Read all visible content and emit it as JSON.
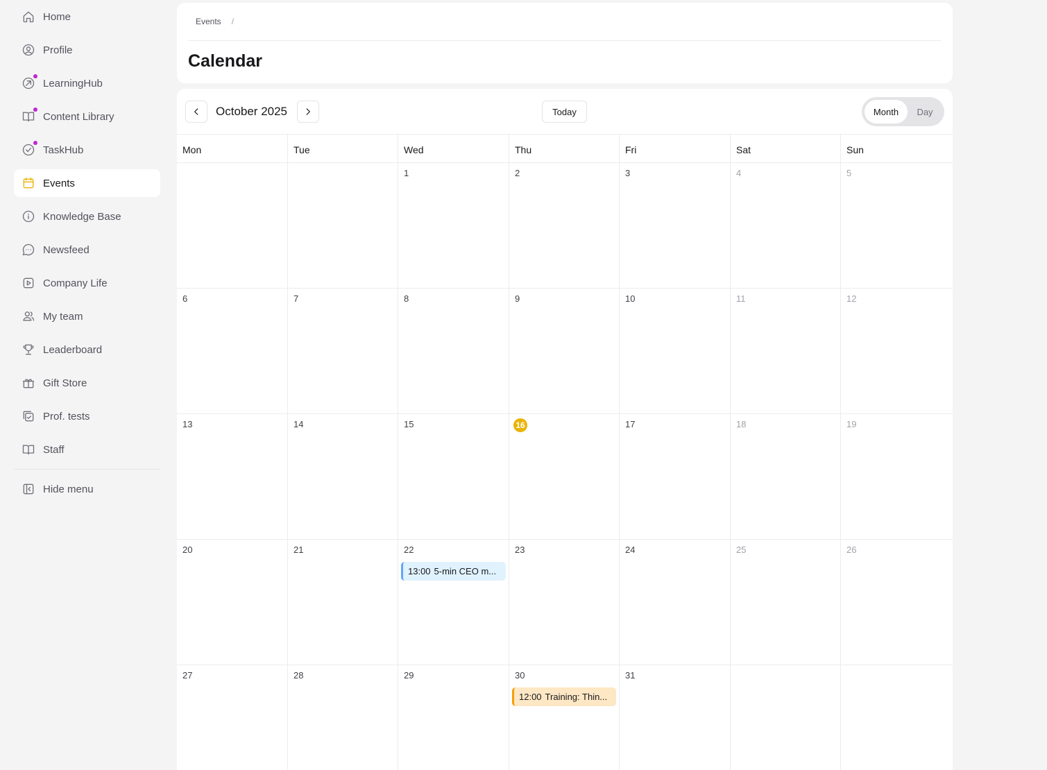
{
  "sidebar": {
    "items": [
      {
        "label": "Home",
        "icon": "home-icon",
        "dot": false,
        "active": false
      },
      {
        "label": "Profile",
        "icon": "user-circle-icon",
        "dot": false,
        "active": false
      },
      {
        "label": "LearningHub",
        "icon": "learning-icon",
        "dot": true,
        "active": false
      },
      {
        "label": "Content Library",
        "icon": "book-open-icon",
        "dot": true,
        "active": false
      },
      {
        "label": "TaskHub",
        "icon": "check-circle-icon",
        "dot": true,
        "active": false
      },
      {
        "label": "Events",
        "icon": "calendar-icon",
        "dot": false,
        "active": true
      },
      {
        "label": "Knowledge Base",
        "icon": "info-icon",
        "dot": false,
        "active": false
      },
      {
        "label": "Newsfeed",
        "icon": "chat-bubble-icon",
        "dot": false,
        "active": false
      },
      {
        "label": "Company Life",
        "icon": "play-square-icon",
        "dot": false,
        "active": false
      },
      {
        "label": "My team",
        "icon": "users-icon",
        "dot": false,
        "active": false
      },
      {
        "label": "Leaderboard",
        "icon": "trophy-icon",
        "dot": false,
        "active": false
      },
      {
        "label": "Gift Store",
        "icon": "gift-icon",
        "dot": false,
        "active": false
      },
      {
        "label": "Prof. tests",
        "icon": "test-check-icon",
        "dot": false,
        "active": false
      },
      {
        "label": "Staff",
        "icon": "book-icon",
        "dot": false,
        "active": false
      }
    ],
    "hide_menu": {
      "label": "Hide menu",
      "icon": "collapse-icon"
    },
    "dot_color": "#c026d3",
    "active_color": "#eab308"
  },
  "header": {
    "breadcrumb": [
      "Events"
    ],
    "breadcrumb_separator": "/",
    "title": "Calendar"
  },
  "calendar": {
    "month_label": "October 2025",
    "today_label": "Today",
    "views": [
      "Month",
      "Day"
    ],
    "active_view": "Month",
    "weekdays": [
      "Mon",
      "Tue",
      "Wed",
      "Thu",
      "Fri",
      "Sat",
      "Sun"
    ],
    "today": 16,
    "weeks": [
      [
        "",
        "",
        "1",
        "2",
        "3",
        "4",
        "5"
      ],
      [
        "6",
        "7",
        "8",
        "9",
        "10",
        "11",
        "12"
      ],
      [
        "13",
        "14",
        "15",
        "16",
        "17",
        "18",
        "19"
      ],
      [
        "20",
        "21",
        "22",
        "23",
        "24",
        "25",
        "26"
      ],
      [
        "27",
        "28",
        "29",
        "30",
        "31",
        "",
        ""
      ]
    ],
    "events": [
      {
        "day": "22",
        "time": "13:00",
        "title": "5-min CEO m...",
        "color": "blue"
      },
      {
        "day": "30",
        "time": "12:00",
        "title": "Training: Thin...",
        "color": "orange"
      }
    ]
  }
}
